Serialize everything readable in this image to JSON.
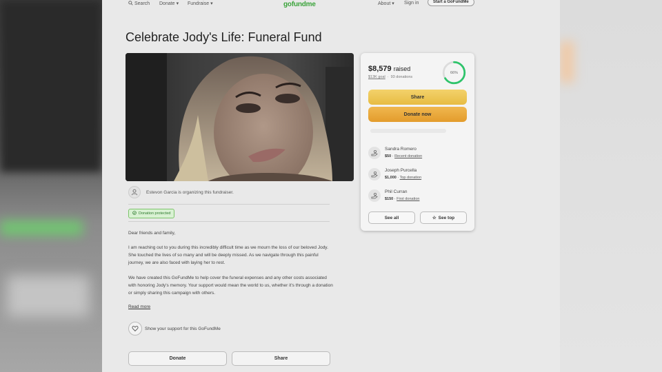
{
  "nav": {
    "search": "Search",
    "donate": "Donate",
    "fundraise": "Fundraise",
    "logo": "gofundme",
    "about": "About",
    "signin": "Sign in",
    "start": "Start a GoFundMe"
  },
  "campaign": {
    "title": "Celebrate Jody's Life: Funeral Fund",
    "organizer_text": "Estevon Garcia is organizing this fundraiser.",
    "badge": "Donation protected",
    "story": [
      "Dear friends and family,",
      "I am reaching out to you during this incredibly difficult time as we mourn the loss of our beloved Jody. She touched the lives of so many and will be deeply missed. As we navigate through this painful journey, we are also faced with laying her to rest.",
      "We have created this GoFundMe to help cover the funeral expenses and any other costs associated with honoring Jody's memory. Your support would mean the world to us, whether it's through a donation or simply sharing this campaign with others."
    ],
    "read_more": "Read more",
    "support_text": "Show your support for this GoFundMe",
    "bottom_donate": "Donate",
    "bottom_share": "Share"
  },
  "sidebar": {
    "raised_amount": "$8,579",
    "raised_suffix": "raised",
    "goal": "$13K goal",
    "separator": "·",
    "donations": "93 donations",
    "progress_percent": 66,
    "progress_label": "66%",
    "share_label": "Share",
    "donate_label": "Donate now",
    "donors": [
      {
        "name": "Sandra Romero",
        "amount": "$50",
        "tag": "Recent donation"
      },
      {
        "name": "Joseph Purcella",
        "amount": "$1,000",
        "tag": "Top donation"
      },
      {
        "name": "Phil Curran",
        "amount": "$150",
        "tag": "First donation"
      }
    ],
    "see_all": "See all",
    "see_top": "See top"
  },
  "colors": {
    "brand_green": "#3aa33a",
    "progress_green": "#2ec46b",
    "share_yellow": "#f0cd5e",
    "donate_orange": "#eaa83a"
  }
}
